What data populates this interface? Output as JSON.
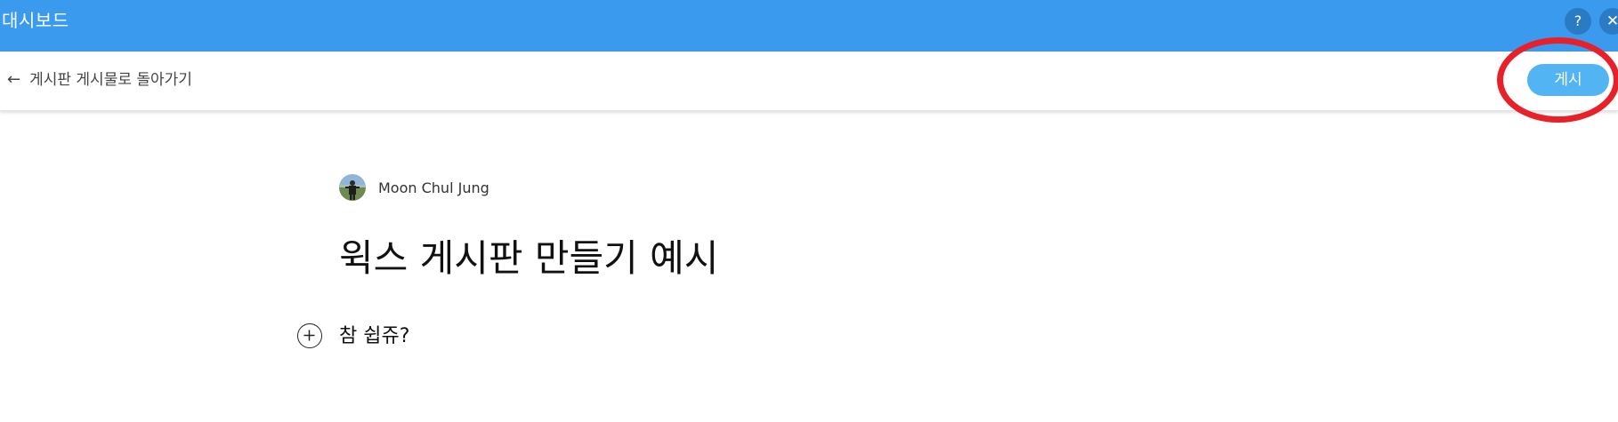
{
  "header": {
    "app_title": "대시보드",
    "help_label": "?",
    "close_label": "✕",
    "bg_color": "#3a9aee"
  },
  "toolbar": {
    "back_arrow": "←",
    "back_label": "게시판 게시물로 돌아가기",
    "publish_label": "게시",
    "publish_color": "#52b4f2",
    "highlight_color": "#e8202a"
  },
  "post": {
    "author_name": "Moon Chul Jung",
    "title": "윅스 게시판 만들기 예시",
    "body": "참 쉽쥬?"
  },
  "icons": [
    "help-icon",
    "close-icon",
    "back-arrow-icon",
    "add-circle-icon",
    "avatar"
  ]
}
